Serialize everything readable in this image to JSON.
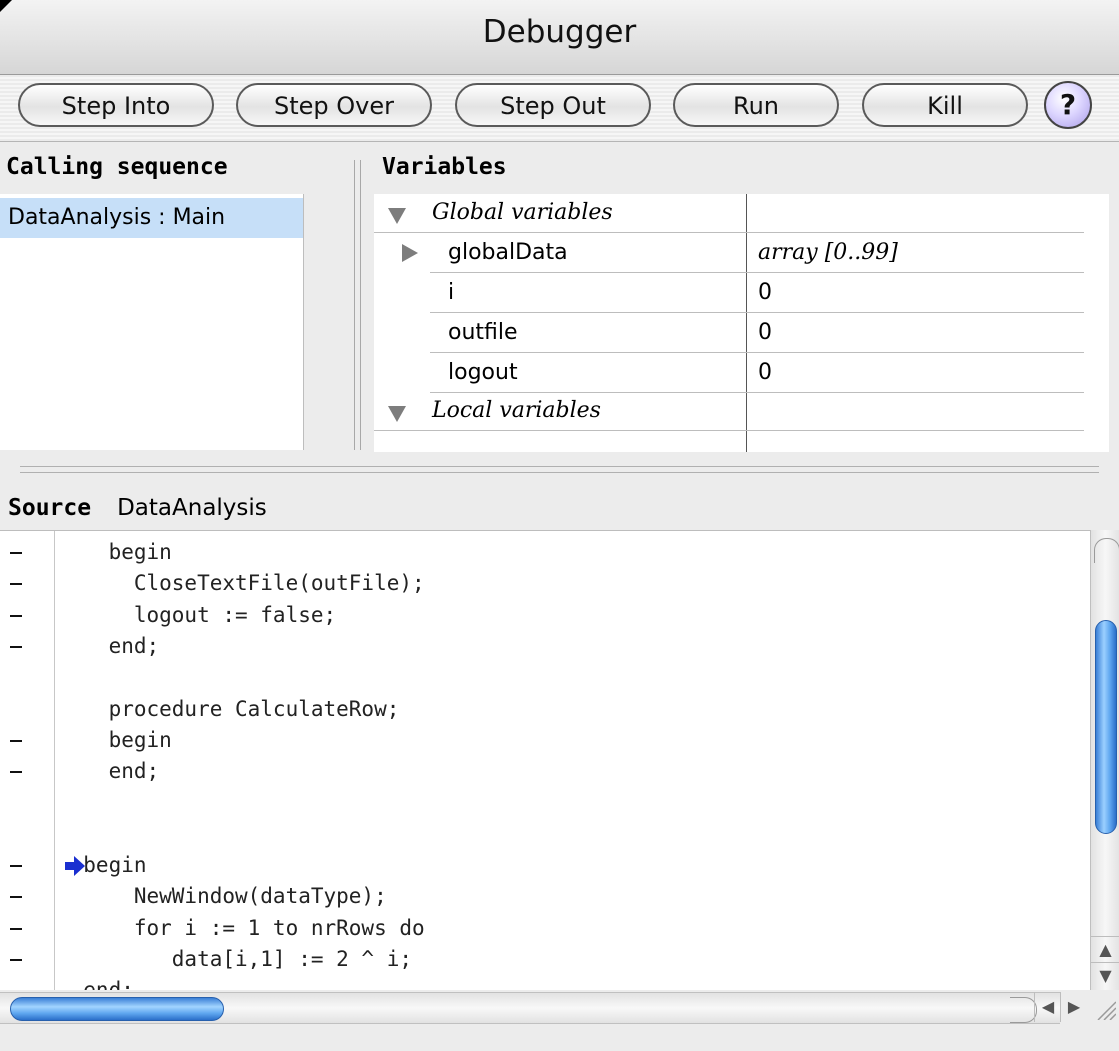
{
  "window": {
    "title": "Debugger"
  },
  "toolbar": {
    "step_into": "Step Into",
    "step_over": "Step Over",
    "step_out": "Step Out",
    "run": "Run",
    "kill": "Kill",
    "help": "?"
  },
  "calling_sequence": {
    "header": "Calling sequence",
    "items": [
      {
        "label": "DataAnalysis : Main",
        "selected": true
      }
    ]
  },
  "variables": {
    "header": "Variables",
    "groups": [
      {
        "label": "Global variables",
        "expanded": true
      },
      {
        "label": "Local variables",
        "expanded": true
      }
    ],
    "rows": [
      {
        "name": "globalData",
        "value": "array [0..99]",
        "expandable": true
      },
      {
        "name": "i",
        "value": "0"
      },
      {
        "name": "outfile",
        "value": "0"
      },
      {
        "name": "logout",
        "value": "0"
      }
    ]
  },
  "source": {
    "header": "Source",
    "file": "DataAnalysis",
    "current_line_index": 10,
    "lines": [
      {
        "text": "    begin",
        "marker": true
      },
      {
        "text": "      CloseTextFile(outFile);",
        "marker": true
      },
      {
        "text": "      logout := false;",
        "marker": true
      },
      {
        "text": "    end;",
        "marker": true
      },
      {
        "text": "",
        "marker": false
      },
      {
        "text": "    procedure CalculateRow;",
        "marker": false
      },
      {
        "text": "    begin",
        "marker": true
      },
      {
        "text": "    end;",
        "marker": true
      },
      {
        "text": "",
        "marker": false
      },
      {
        "text": "",
        "marker": false
      },
      {
        "text": "  begin",
        "marker": true
      },
      {
        "text": "      NewWindow(dataType);",
        "marker": true
      },
      {
        "text": "      for i := 1 to nrRows do",
        "marker": true
      },
      {
        "text": "         data[i,1] := 2 ^ i;",
        "marker": true
      },
      {
        "text": "  end;",
        "marker": true
      }
    ]
  },
  "colors": {
    "selection": "#c6dff8",
    "scroll_thumb": "#5ea6ef",
    "current_line_arrow": "#1a2fd0"
  }
}
